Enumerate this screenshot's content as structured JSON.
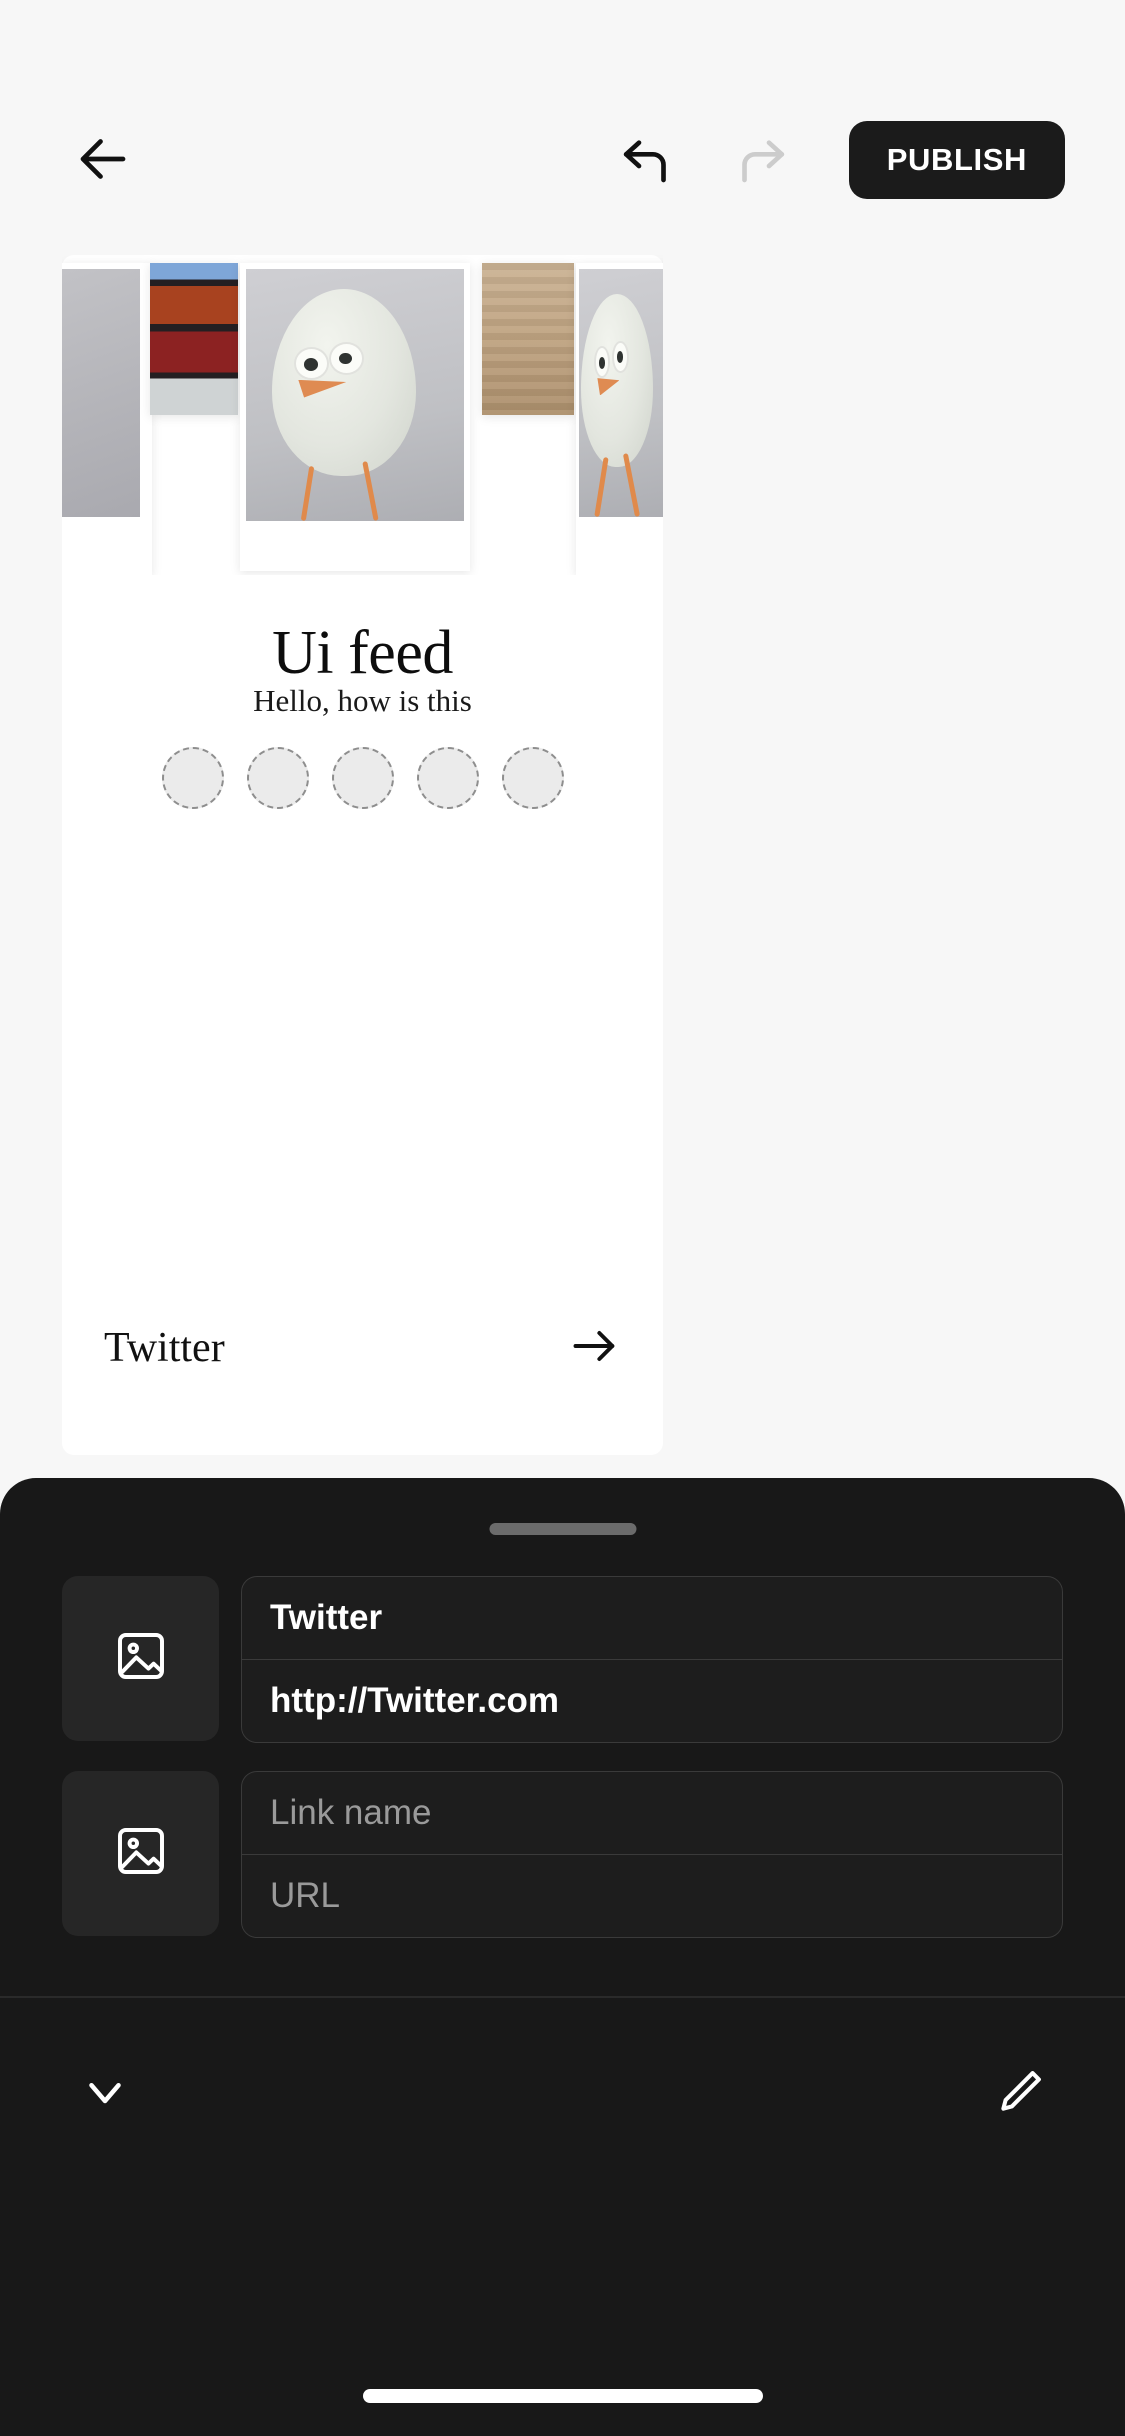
{
  "toolbar": {
    "back_icon": "arrow-left-icon",
    "undo_icon": "undo-arrow-icon",
    "redo_icon": "redo-arrow-icon",
    "publish_label": "PUBLISH"
  },
  "preview": {
    "title": "Ui feed",
    "subtitle": "Hello, how is this",
    "placeholder_circle_count": 5,
    "link_name": "Twitter",
    "link_arrow_icon": "arrow-right-icon"
  },
  "sheet": {
    "grabber": "drag-handle",
    "rows": [
      {
        "thumb_icon": "image-placeholder-icon",
        "name_value": "Twitter",
        "name_placeholder": "Link name",
        "url_value": "http://Twitter.com",
        "url_placeholder": "URL"
      },
      {
        "thumb_icon": "image-placeholder-icon",
        "name_value": "",
        "name_placeholder": "Link name",
        "url_value": "",
        "url_placeholder": "URL"
      }
    ],
    "collapse_icon": "chevron-down-icon",
    "edit_icon": "pencil-icon"
  },
  "colors": {
    "app_background": "#f7f7f7",
    "sheet_background": "#181818",
    "accent_dark": "#1b1b1b",
    "placeholder_text": "#9a9a9a",
    "field_border": "#3a3a3a"
  }
}
